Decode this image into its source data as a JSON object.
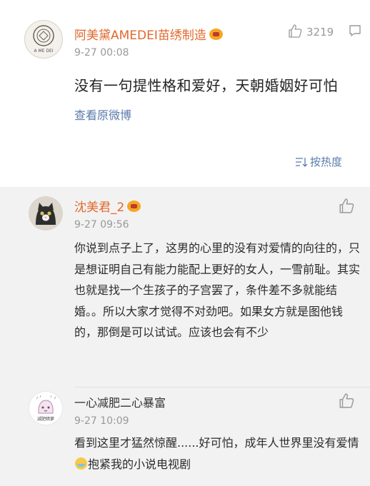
{
  "post": {
    "username": "阿美黛AMEDEI苗绣制造",
    "avatar_text": "A ME DEI",
    "time": "9-27 00:08",
    "likes": "3219",
    "content": "没有一句提性格和爱好，天朝婚姻好可怕",
    "view_original": "查看原微博",
    "sort_label": "按热度"
  },
  "replies": [
    {
      "username": "沈美君_2",
      "time": "9-27 09:56",
      "content": "你说到点子上了，这男的心里的没有对爱情的向往的，只是想证明自己有能力能配上更好的女人，一雪前耻。其实也就是找一个生孩子的子宫罢了，条件差不多就能结婚。。所以大家才觉得不对劲吧。如果女方就是图他钱的，那倒是可以试试。应该也会有不少"
    },
    {
      "username": "一心减肥二心暴富",
      "avatar_text": "减肥暗萝",
      "time": "9-27 10:09",
      "content_a": "看到这里才猛然惊醒......好可怕，成年人世界里没有爱情",
      "emoji": "sweat-smile-emoji",
      "content_b": "抱紧我的小说电视剧"
    }
  ],
  "colors": {
    "username": "#e1682c",
    "link": "#5b7bab",
    "time": "#999999",
    "reply_bg": "#f2f2f2"
  },
  "icons": [
    "thumbs-up-icon",
    "comment-icon",
    "sort-icon",
    "vip-badge-icon"
  ]
}
